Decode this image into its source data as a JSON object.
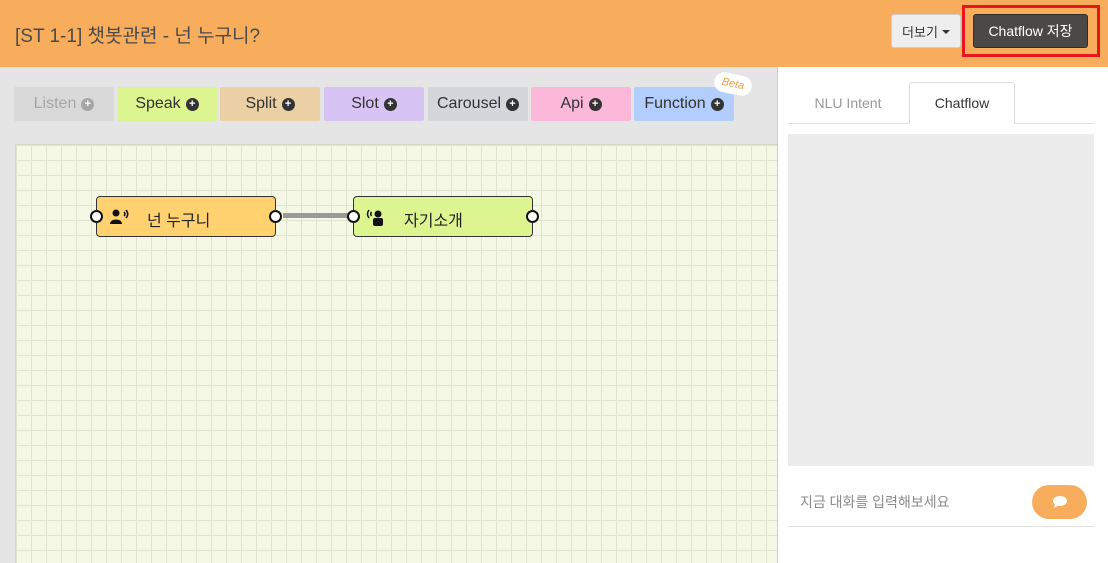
{
  "header": {
    "title": "[ST 1-1] 챗봇관련 - 넌 누구니?",
    "more_label": "더보기",
    "save_label": "Chatflow 저장"
  },
  "palette": {
    "listen": "Listen",
    "speak": "Speak",
    "split": "Split",
    "slot": "Slot",
    "carousel": "Carousel",
    "api": "Api",
    "function": "Function",
    "beta": "Beta",
    "plus_icon": "plus-circle-icon"
  },
  "nodes": [
    {
      "label": "넌 누구니",
      "icon": "user-speaking-icon",
      "color": "#ffd26f"
    },
    {
      "label": "자기소개",
      "icon": "broadcast-person-icon",
      "color": "#ddf591"
    }
  ],
  "side_panel": {
    "tabs": [
      "NLU Intent",
      "Chatflow"
    ],
    "active_tab": "Chatflow",
    "chat_placeholder": "지금 대화를 입력해보세요",
    "send_icon": "chat-bubble-icon"
  },
  "colors": {
    "header_bg": "#f8ad5c",
    "save_highlight": "#e8161d",
    "save_btn_bg": "#4b4948"
  }
}
